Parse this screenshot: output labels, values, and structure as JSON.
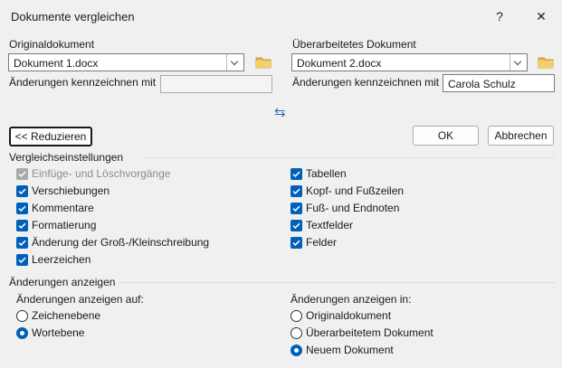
{
  "window": {
    "title": "Dokumente vergleichen",
    "help_label": "?",
    "close_label": "✕"
  },
  "original": {
    "label": "Originaldokument",
    "value": "Dokument 1.docx",
    "mark_label": "Änderungen kennzeichnen mit",
    "mark_value": ""
  },
  "revised": {
    "label": "Überarbeitetes Dokument",
    "value": "Dokument 2.docx",
    "mark_label": "Änderungen kennzeichnen mit",
    "mark_value": "Carola Schulz"
  },
  "swap_icon": "⇆",
  "buttons": {
    "reduce": "<< Reduzieren",
    "ok": "OK",
    "cancel": "Abbrechen"
  },
  "compare_settings": {
    "title": "Vergleichseinstellungen",
    "left": [
      {
        "label": "Einfüge- und Löschvorgänge",
        "checked": true,
        "disabled": true
      },
      {
        "label": "Verschiebungen",
        "checked": true,
        "disabled": false
      },
      {
        "label": "Kommentare",
        "checked": true,
        "disabled": false
      },
      {
        "label": "Formatierung",
        "checked": true,
        "disabled": false
      },
      {
        "label": "Änderung der Groß-/Kleinschreibung",
        "checked": true,
        "disabled": false
      },
      {
        "label": "Leerzeichen",
        "checked": true,
        "disabled": false
      }
    ],
    "right": [
      {
        "label": "Tabellen",
        "checked": true,
        "disabled": false
      },
      {
        "label": "Kopf- und Fußzeilen",
        "checked": true,
        "disabled": false
      },
      {
        "label": "Fuß- und Endnoten",
        "checked": true,
        "disabled": false
      },
      {
        "label": "Textfelder",
        "checked": true,
        "disabled": false
      },
      {
        "label": "Felder",
        "checked": true,
        "disabled": false
      }
    ]
  },
  "show_changes": {
    "title": "Änderungen anzeigen",
    "level": {
      "title": "Änderungen anzeigen auf:",
      "options": [
        "Zeichenebene",
        "Wortebene"
      ],
      "selected": 1
    },
    "in": {
      "title": "Änderungen anzeigen in:",
      "options": [
        "Originaldokument",
        "Überarbeitetem Dokument",
        "Neuem Dokument"
      ],
      "selected": 2
    }
  },
  "colors": {
    "accent": "#005fb8",
    "disabled": "#a9a9a9",
    "folder": "#e8b84a"
  }
}
